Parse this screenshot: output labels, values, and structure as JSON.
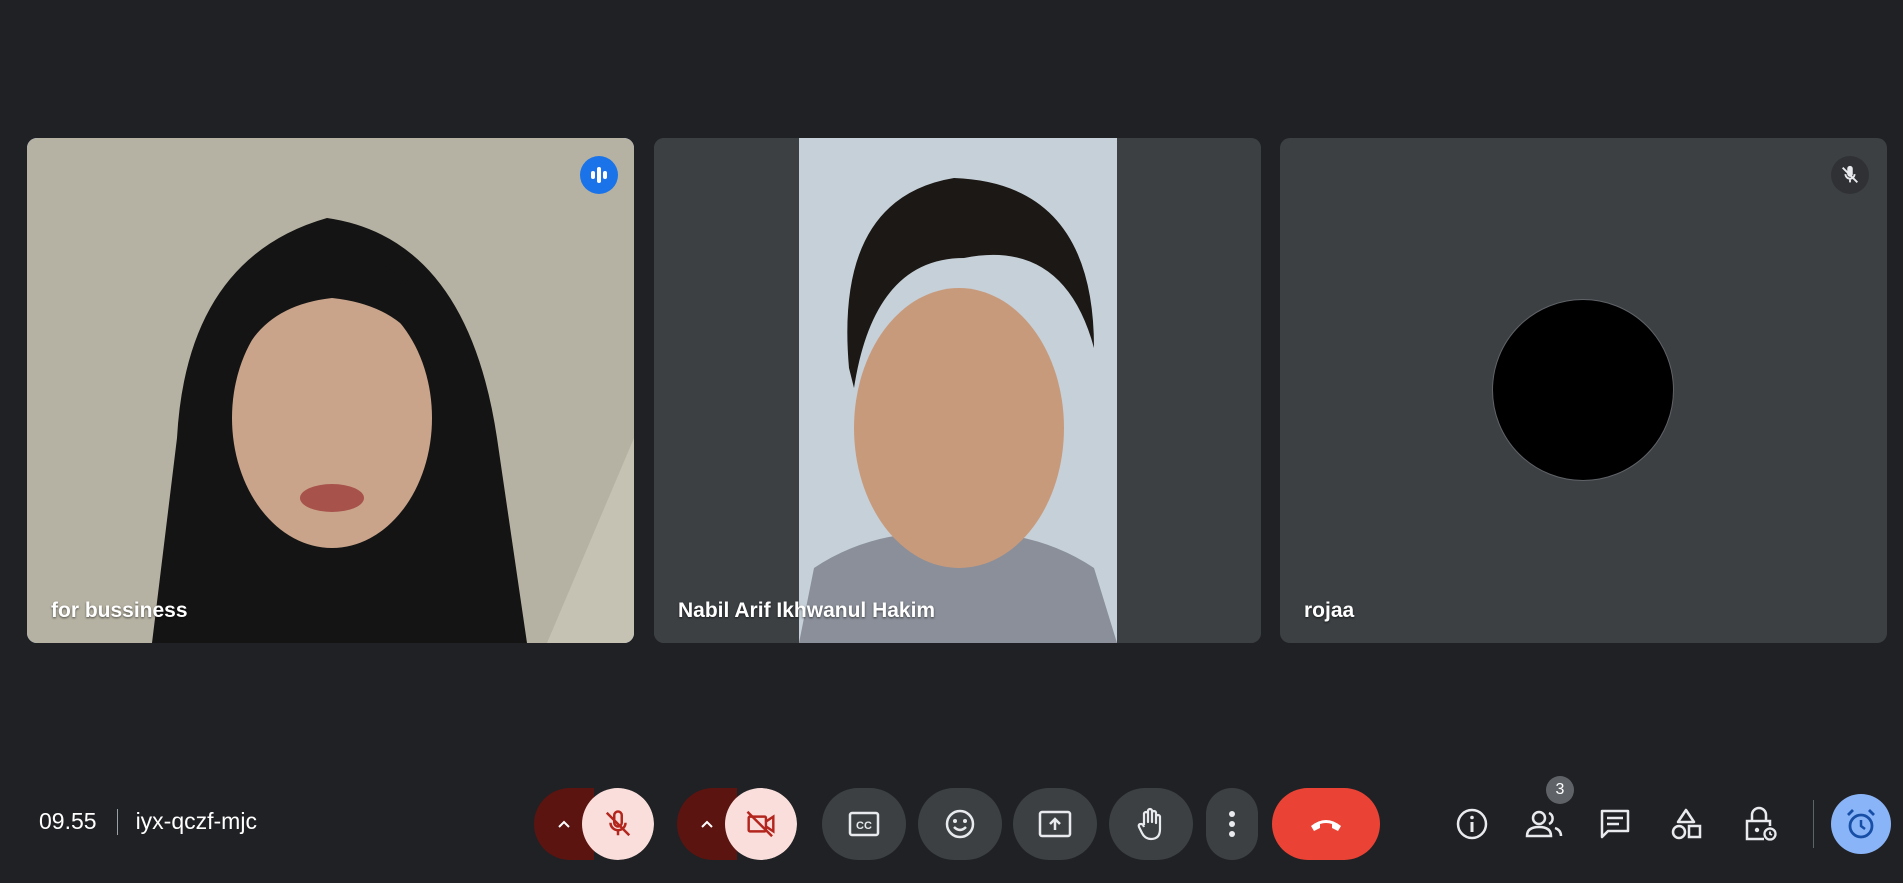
{
  "participants": [
    {
      "name": "for bussiness",
      "speaking": true
    },
    {
      "name": "Nabil Arif Ikhwanul Hakim"
    },
    {
      "name": "rojaa",
      "muted": true
    }
  ],
  "meeting": {
    "time": "09.55",
    "code": "iyx-qczf-mjc"
  },
  "people_count": "3",
  "colors": {
    "background": "#202124",
    "tile": "#3c4043",
    "active_border": "#8ab4f8",
    "end_call": "#ea4335",
    "mic_off_bg": "#f9dedc"
  },
  "icons": {
    "mic": "mic-off-icon",
    "camera": "videocam-off-icon",
    "captions": "closed-caption-icon",
    "emoji": "emoji-icon",
    "present": "present-screen-icon",
    "hand": "raise-hand-icon",
    "more": "more-vert-icon",
    "end": "call-end-icon",
    "info": "info-icon",
    "people": "people-icon",
    "chat": "chat-icon",
    "activities": "activities-icon",
    "host": "host-controls-icon",
    "timer": "timer-icon"
  }
}
